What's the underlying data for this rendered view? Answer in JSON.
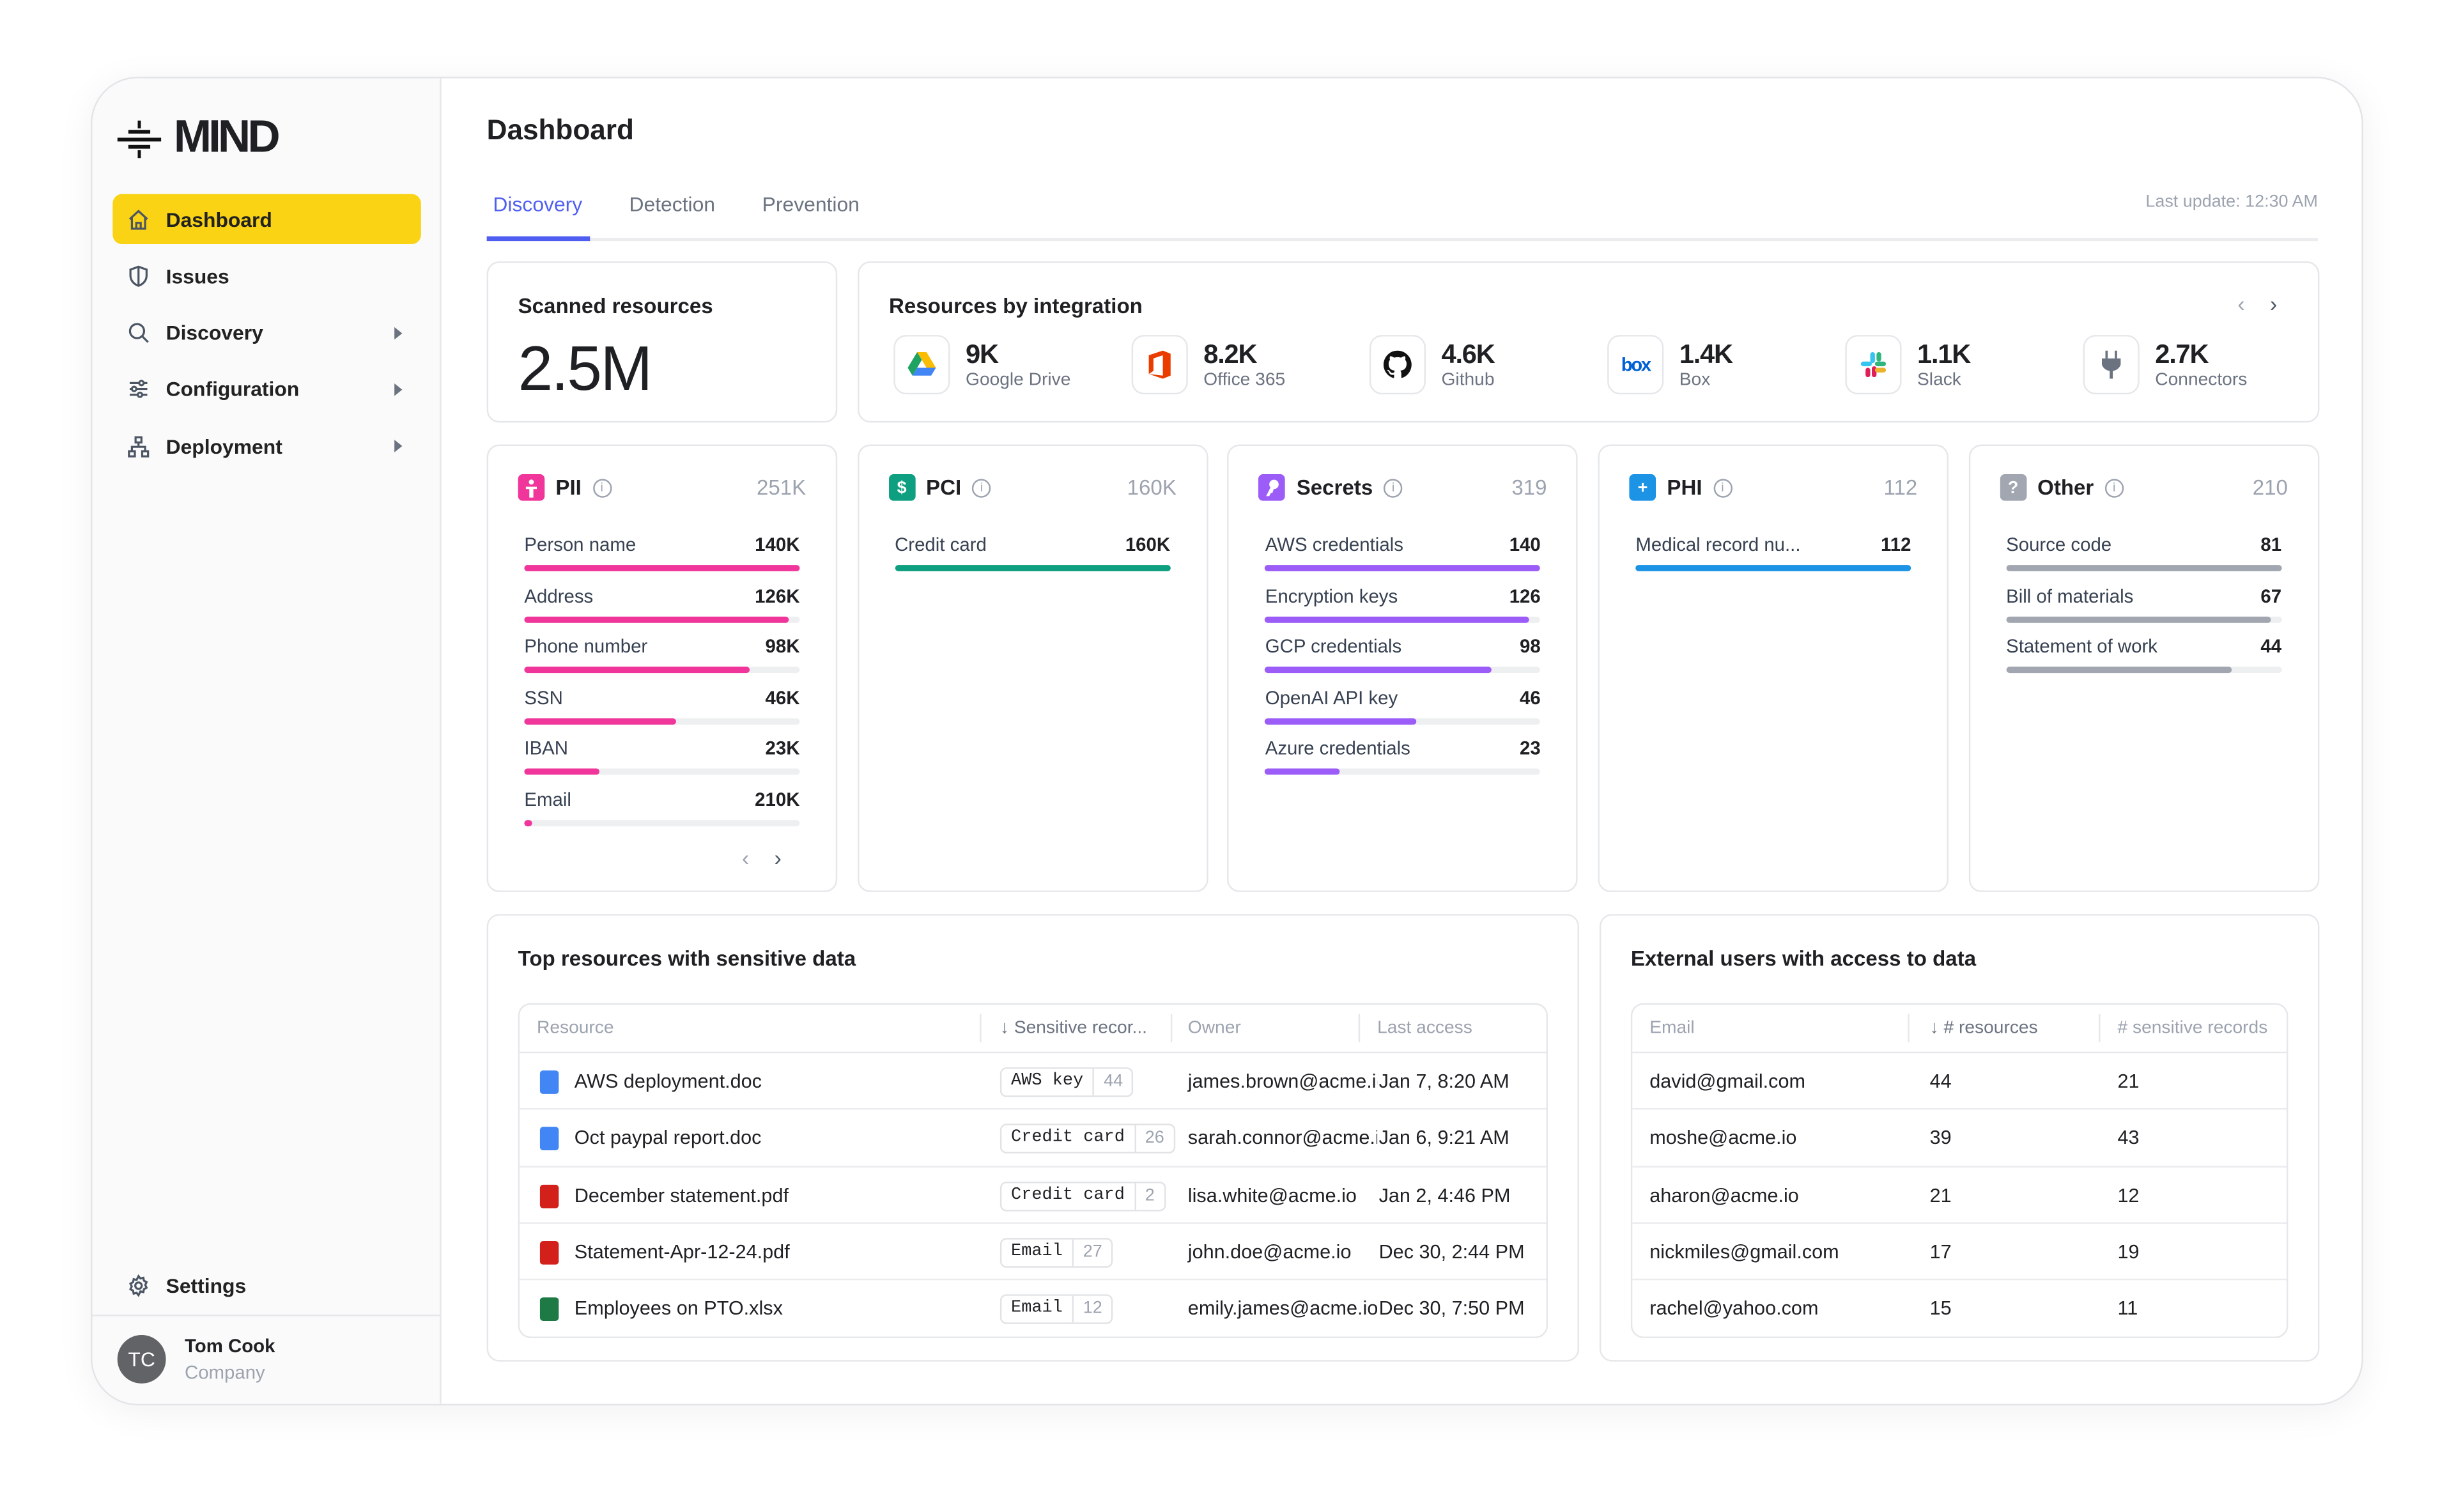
{
  "brand": "MIND",
  "colors": {
    "accent": "#4f5ef0",
    "nav_active": "#f9d314",
    "pii": "#f0369b",
    "pci": "#0e9f80",
    "secrets": "#9b5cf7",
    "phi": "#1d93e6",
    "other": "#a1a6b0"
  },
  "sidebar": {
    "items": [
      {
        "label": "Dashboard",
        "icon": "home-icon",
        "active": true
      },
      {
        "label": "Issues",
        "icon": "shield-icon"
      },
      {
        "label": "Discovery",
        "icon": "search-icon",
        "expandable": true
      },
      {
        "label": "Configuration",
        "icon": "sliders-icon",
        "expandable": true
      },
      {
        "label": "Deployment",
        "icon": "network-icon",
        "expandable": true
      }
    ],
    "settings": "Settings",
    "user": {
      "initials": "TC",
      "name": "Tom Cook",
      "company": "Company"
    }
  },
  "header": {
    "title": "Dashboard",
    "tabs": [
      "Discovery",
      "Detection",
      "Prevention"
    ],
    "active_tab": "Discovery",
    "last_update": "Last update: 12:30 AM"
  },
  "scanned": {
    "title": "Scanned resources",
    "value": "2.5M"
  },
  "integrations": {
    "title": "Resources by integration",
    "items": [
      {
        "value": "9K",
        "label": "Google Drive",
        "icon": "google-drive-icon"
      },
      {
        "value": "8.2K",
        "label": "Office 365",
        "icon": "office-365-icon"
      },
      {
        "value": "4.6K",
        "label": "Github",
        "icon": "github-icon"
      },
      {
        "value": "1.4K",
        "label": "Box",
        "icon": "box-icon"
      },
      {
        "value": "1.1K",
        "label": "Slack",
        "icon": "slack-icon"
      },
      {
        "value": "2.7K",
        "label": "Connectors",
        "icon": "plug-icon"
      }
    ]
  },
  "categories": [
    {
      "name": "PII",
      "total": "251K",
      "icon": "person-icon",
      "color": "#f0369b",
      "glyph": "",
      "items": [
        {
          "label": "Person name",
          "value": "140K",
          "fill": 1.0
        },
        {
          "label": "Address",
          "value": "126K",
          "fill": 0.96
        },
        {
          "label": "Phone number",
          "value": "98K",
          "fill": 0.82
        },
        {
          "label": "SSN",
          "value": "46K",
          "fill": 0.55
        },
        {
          "label": "IBAN",
          "value": "23K",
          "fill": 0.27
        },
        {
          "label": "Email",
          "value": "210K",
          "fill": 0.03
        }
      ]
    },
    {
      "name": "PCI",
      "total": "160K",
      "icon": "dollar-icon",
      "color": "#0e9f80",
      "glyph": "$",
      "items": [
        {
          "label": "Credit card",
          "value": "160K",
          "fill": 1.0
        }
      ]
    },
    {
      "name": "Secrets",
      "total": "319",
      "icon": "key-icon",
      "color": "#9b5cf7",
      "glyph": "",
      "items": [
        {
          "label": "AWS credentials",
          "value": "140",
          "fill": 1.0
        },
        {
          "label": "Encryption keys",
          "value": "126",
          "fill": 0.96
        },
        {
          "label": "GCP credentials",
          "value": "98",
          "fill": 0.82
        },
        {
          "label": "OpenAI API key",
          "value": "46",
          "fill": 0.55
        },
        {
          "label": "Azure credentials",
          "value": "23",
          "fill": 0.27
        }
      ]
    },
    {
      "name": "PHI",
      "total": "112",
      "icon": "medical-kit-icon",
      "color": "#1d93e6",
      "glyph": "+",
      "items": [
        {
          "label": "Medical record nu...",
          "value": "112",
          "fill": 1.0
        }
      ]
    },
    {
      "name": "Other",
      "total": "210",
      "icon": "question-icon",
      "color": "#a1a6b0",
      "glyph": "?",
      "items": [
        {
          "label": "Source code",
          "value": "81",
          "fill": 1.0
        },
        {
          "label": "Bill of materials",
          "value": "67",
          "fill": 0.96
        },
        {
          "label": "Statement of work",
          "value": "44",
          "fill": 0.82
        }
      ]
    }
  ],
  "top_resources": {
    "title": "Top resources with sensitive data",
    "columns": [
      "Resource",
      "↓ Sensitive recor...",
      "Owner",
      "Last access"
    ],
    "rows": [
      {
        "name": "AWS deployment.doc",
        "type": "doc",
        "tag": "AWS key",
        "count": "44",
        "owner": "james.brown@acme.io",
        "last": "Jan 7, 8:20 AM"
      },
      {
        "name": "Oct paypal report.doc",
        "type": "doc",
        "tag": "Credit card",
        "count": "26",
        "owner": "sarah.connor@acme.io",
        "last": "Jan 6, 9:21 AM"
      },
      {
        "name": "December statement.pdf",
        "type": "pdf",
        "tag": "Credit card",
        "count": "2",
        "owner": "lisa.white@acme.io",
        "last": "Jan 2, 4:46 PM"
      },
      {
        "name": "Statement-Apr-12-24.pdf",
        "type": "pdf",
        "tag": "Email",
        "count": "27",
        "owner": "john.doe@acme.io",
        "last": "Dec 30, 2:44 PM"
      },
      {
        "name": "Employees on PTO.xlsx",
        "type": "xlsx",
        "tag": "Email",
        "count": "12",
        "owner": "emily.james@acme.io",
        "last": "Dec 30, 7:50 PM"
      }
    ]
  },
  "external_users": {
    "title": "External users with access to data",
    "columns": [
      "Email",
      "↓ # resources",
      "# sensitive records"
    ],
    "rows": [
      {
        "email": "david@gmail.com",
        "resources": "44",
        "records": "21"
      },
      {
        "email": "moshe@acme.io",
        "resources": "39",
        "records": "43"
      },
      {
        "email": "aharon@acme.io",
        "resources": "21",
        "records": "12"
      },
      {
        "email": "nickmiles@gmail.com",
        "resources": "17",
        "records": "19"
      },
      {
        "email": "rachel@yahoo.com",
        "resources": "15",
        "records": "11"
      }
    ]
  }
}
